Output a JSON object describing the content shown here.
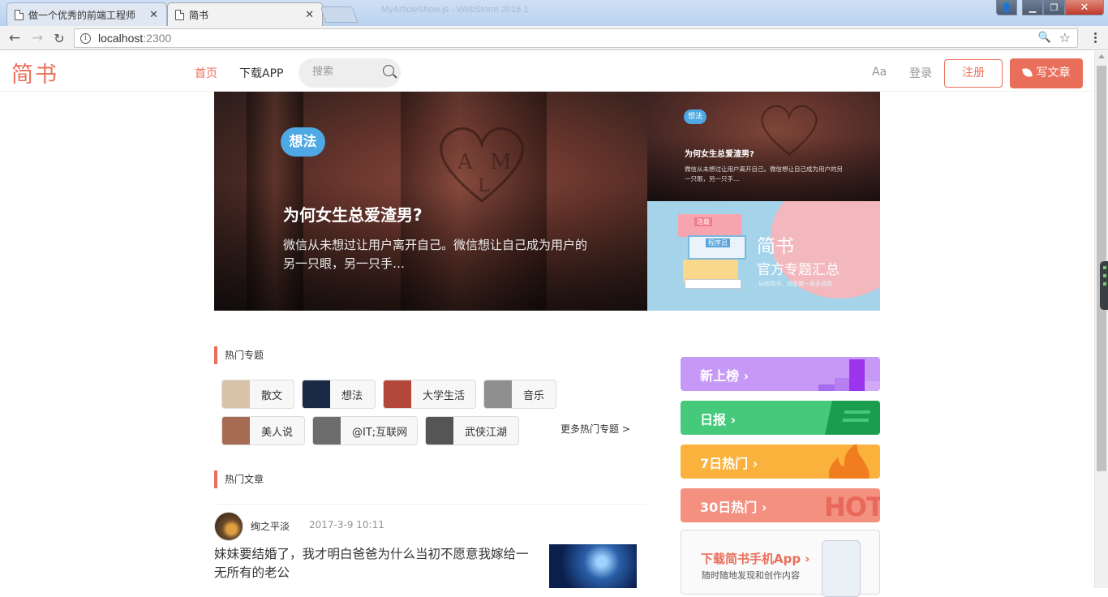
{
  "browser": {
    "tabs": [
      {
        "title": "做一个优秀的前端工程师",
        "active": false
      },
      {
        "title": "简书",
        "active": true
      }
    ],
    "background_title": "MyArticleShow.js - WebStorm 2016.1",
    "url_host": "localhost",
    "url_port": ":2300"
  },
  "nav": {
    "logo": "简书",
    "home": "首页",
    "download_app": "下载APP",
    "search_placeholder": "搜索",
    "aa": "Aa",
    "login": "登录",
    "register": "注册",
    "write": "写文章"
  },
  "banner": {
    "main": {
      "tag": "想法",
      "title": "为何女生总爱渣男?",
      "desc": "微信从未想过让用户离开自己。微信想让自己成为用户的另一只眼，另一只手…"
    },
    "small": {
      "tag": "想法",
      "title": "为何女生总爱渣男?",
      "desc": "微信从未想过让用户离开自己。微信想让自己成为用户的另一只眼，另一只手…"
    },
    "official": {
      "title": "简书",
      "subtitle": "官方专题汇总",
      "tiny": "玩转简书，就是做一直多选题",
      "card1": "连载",
      "card2": "程序员"
    }
  },
  "hot_topics": {
    "title": "热门专题",
    "items": [
      {
        "label": "散文",
        "color": "#d8c2a8"
      },
      {
        "label": "想法",
        "color": "#1b2a44"
      },
      {
        "label": "大学生活",
        "color": "#b2473a"
      },
      {
        "label": "音乐",
        "color": "#8f8f8f"
      },
      {
        "label": "美人说",
        "color": "#a66b52"
      },
      {
        "label": "@IT;互联网",
        "color": "#6d6d6d"
      },
      {
        "label": "武侠江湖",
        "color": "#555555"
      }
    ],
    "more": "更多热门专题 >"
  },
  "hot_articles": {
    "title": "热门文章",
    "items": [
      {
        "author": "绚之平淡",
        "time": "2017-3-9 10:11",
        "title": "妹妹要结婚了，我才明白爸爸为什么当初不愿意我嫁给一无所有的老公"
      }
    ]
  },
  "boards": [
    {
      "label": "新上榜 ›",
      "color": "#c599f5"
    },
    {
      "label": "日报 ›",
      "color": "#45c97a"
    },
    {
      "label": "7日热门 ›",
      "color": "#fbb23c"
    },
    {
      "label": "30日热门 ›",
      "color": "#f39080"
    }
  ],
  "download": {
    "title": "下载简书手机App ›",
    "subtitle": "随时随地发现和创作内容"
  },
  "colors": {
    "accent": "#ea6f5a",
    "tag_blue": "#4ea8e3"
  }
}
